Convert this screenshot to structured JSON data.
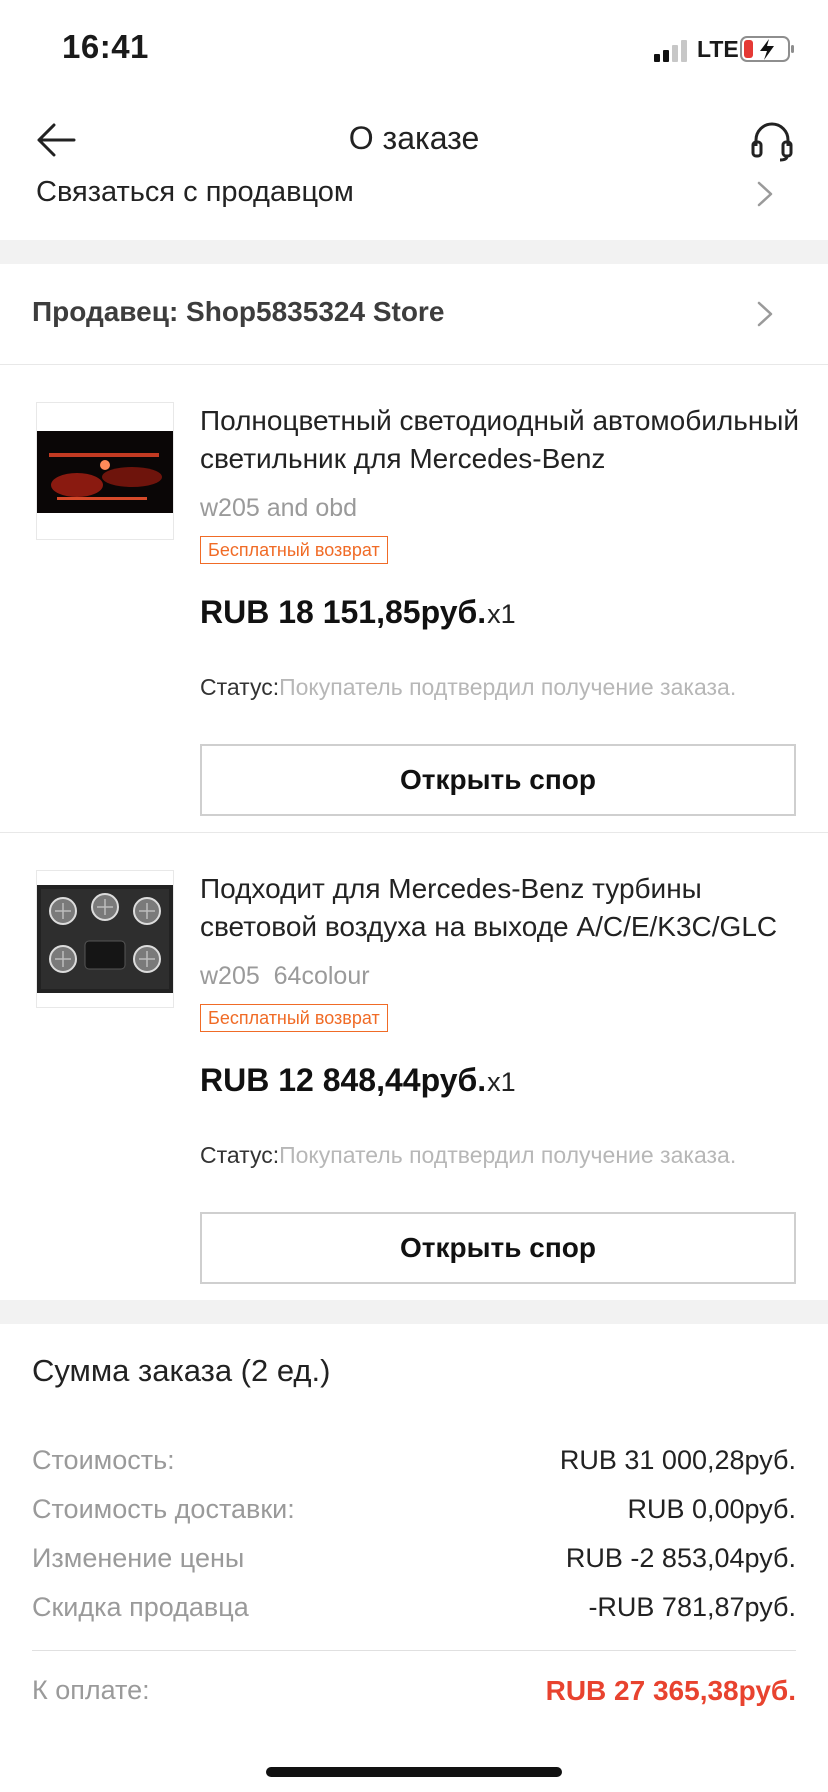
{
  "status_bar": {
    "time": "16:41",
    "network": "LTE",
    "battery_color": "#e53935"
  },
  "header": {
    "title": "О заказе",
    "back_icon": "arrow-left-icon",
    "support_icon": "headset-icon"
  },
  "contact_seller": {
    "label": "Связаться с продавцом",
    "icon": "chevron-right-icon"
  },
  "seller": {
    "label": "Продавец: Shop5835324 Store",
    "icon": "chevron-right-icon"
  },
  "products": [
    {
      "title": "Полноцветный светодиодный автомобильный светильник для Mercedes-Benz",
      "variant": "w205 and obd",
      "badge": "Бесплатный возврат",
      "price": "RUB 18 151,85руб.",
      "quantity": "x1",
      "status_label": "Статус:",
      "status_value": "Покупатель подтвердил получение заказа.",
      "dispute_button": "Открыть спор"
    },
    {
      "title": "Подходит для Mercedes-Benz турбины световой воздуха на выходе A/C/E/K3C/GLC",
      "variant": "w205  64colour",
      "badge": "Бесплатный возврат",
      "price": "RUB 12 848,44руб.",
      "quantity": "x1",
      "status_label": "Статус:",
      "status_value": "Покупатель подтвердил получение заказа.",
      "dispute_button": "Открыть спор"
    }
  ],
  "summary": {
    "title": "Сумма заказа (2 ед.)",
    "rows": [
      {
        "label": "Стоимость:",
        "value": "RUB 31 000,28руб."
      },
      {
        "label": "Стоимость доставки:",
        "value": "RUB 0,00руб."
      },
      {
        "label": "Изменение цены",
        "value": "RUB -2 853,04руб."
      },
      {
        "label": "Скидка продавца",
        "value": "-RUB 781,87руб."
      }
    ],
    "to_pay_label": "К оплате:",
    "to_pay_value": "RUB 27 365,38руб.",
    "to_pay_color": "#e8432f"
  }
}
